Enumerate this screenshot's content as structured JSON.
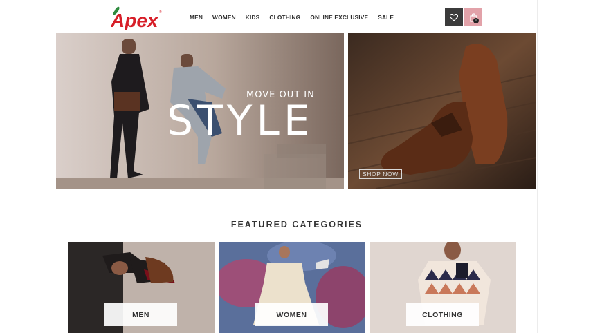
{
  "brand": {
    "name": "Apex",
    "color": "#d71e28",
    "accent": "#2e8b3e"
  },
  "nav": {
    "items": [
      {
        "label": "MEN"
      },
      {
        "label": "WOMEN"
      },
      {
        "label": "KIDS"
      },
      {
        "label": "CLOTHING"
      },
      {
        "label": "ONLINE EXCLUSIVE"
      },
      {
        "label": "SALE"
      }
    ]
  },
  "header": {
    "wishlist_icon": "heart-icon",
    "cart_icon": "shopping-bag-icon",
    "cart_count": "0"
  },
  "hero": {
    "subtitle": "MOVE OUT IN",
    "title": "STYLE",
    "shop_now_label": "SHOP NOW"
  },
  "featured": {
    "title": "FEATURED CATEGORIES",
    "categories": [
      {
        "label": "MEN"
      },
      {
        "label": "WOMEN"
      },
      {
        "label": "CLOTHING"
      }
    ]
  }
}
